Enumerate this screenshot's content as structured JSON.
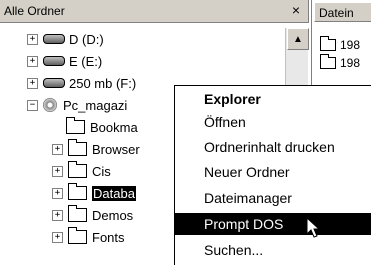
{
  "folder_pane": {
    "title": "Alle Ordner",
    "close_glyph": "×",
    "scroll_up_glyph": "▲"
  },
  "tree": {
    "drive_d": "D (D:)",
    "drive_e": "E (E:)",
    "drive_f": "250 mb (F:)",
    "pc_magazin": "Pc_magazi",
    "bookmarks": "Bookma",
    "browser": "Browser",
    "cis": "Cis",
    "database": "Databa",
    "demos": "Demos",
    "fonts": "Fonts"
  },
  "file_pane": {
    "column_header": "Datein",
    "items": [
      "198",
      "198"
    ]
  },
  "context_menu": {
    "items": [
      {
        "label": "Explorer",
        "default": true
      },
      {
        "label": "Öffnen"
      },
      {
        "label": "Ordnerinhalt drucken"
      },
      {
        "label": "Neuer Ordner"
      },
      {
        "label": "Dateimanager"
      },
      {
        "label": "Prompt DOS",
        "highlighted": true
      },
      {
        "label": "Suchen..."
      }
    ]
  },
  "colors": {
    "highlight": "#000000",
    "highlight_text": "#ffffff",
    "chrome": "#d4d0c8"
  }
}
